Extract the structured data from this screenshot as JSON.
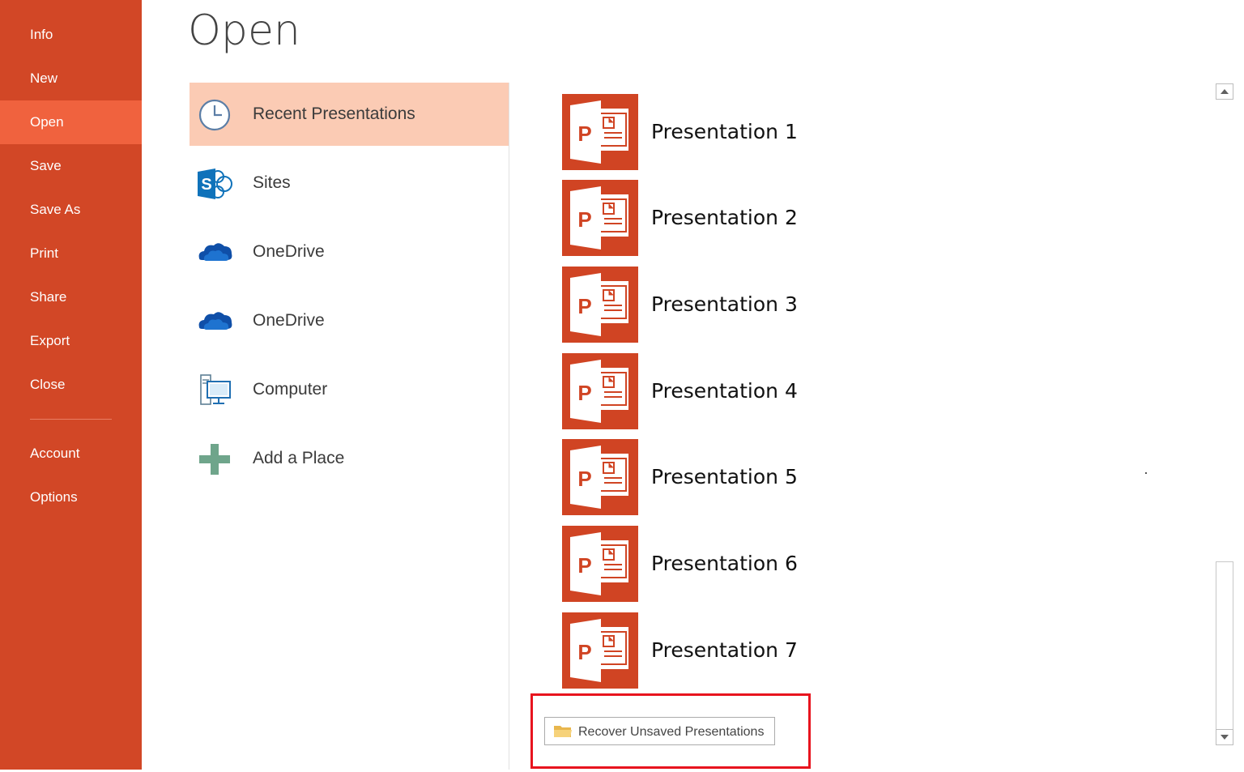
{
  "nav": {
    "items": [
      {
        "label": "Info"
      },
      {
        "label": "New"
      },
      {
        "label": "Open",
        "active": true
      },
      {
        "label": "Save"
      },
      {
        "label": "Save As"
      },
      {
        "label": "Print"
      },
      {
        "label": "Share"
      },
      {
        "label": "Export"
      },
      {
        "label": "Close"
      }
    ],
    "bottom_items": [
      {
        "label": "Account"
      },
      {
        "label": "Options"
      }
    ]
  },
  "page_title": "Open",
  "places": [
    {
      "label": "Recent Presentations",
      "icon": "clock-icon",
      "active": true
    },
    {
      "label": "Sites",
      "icon": "sharepoint-icon"
    },
    {
      "label": "OneDrive",
      "icon": "onedrive-icon"
    },
    {
      "label": "OneDrive",
      "icon": "onedrive-icon"
    },
    {
      "label": "Computer",
      "icon": "computer-icon"
    },
    {
      "label": "Add a Place",
      "icon": "plus-icon"
    }
  ],
  "presentations": [
    {
      "name": "Presentation 1",
      "icon": "powerpoint-icon"
    },
    {
      "name": "Presentation 2",
      "icon": "powerpoint-icon"
    },
    {
      "name": "Presentation 3",
      "icon": "powerpoint-icon"
    },
    {
      "name": "Presentation 4",
      "icon": "powerpoint-icon"
    },
    {
      "name": "Presentation 5",
      "icon": "powerpoint-icon"
    },
    {
      "name": "Presentation 6",
      "icon": "powerpoint-icon"
    },
    {
      "name": "Presentation 7",
      "icon": "powerpoint-icon"
    }
  ],
  "recover_button": {
    "label": "Recover Unsaved Presentations",
    "icon": "folder-icon"
  },
  "colors": {
    "nav_bg": "#D24726",
    "nav_active": "#F0623E",
    "place_active": "#FBCBB4",
    "ppt_red": "#D04423",
    "highlight": "#E8141E"
  }
}
